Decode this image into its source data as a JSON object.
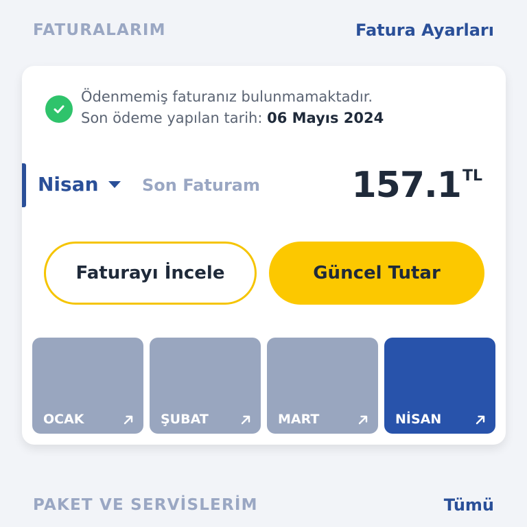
{
  "header": {
    "title": "FATURALARIM",
    "settings_link": "Fatura Ayarları"
  },
  "status": {
    "message": "Ödenmemiş faturanız bulunmamaktadır.",
    "last_payment_label": "Son ödeme yapılan tarih:",
    "last_payment_date": "06 Mayıs 2024"
  },
  "bill": {
    "selected_month": "Nisan",
    "label": "Son Faturam",
    "amount": "157.1",
    "currency": "TL"
  },
  "buttons": {
    "review": "Faturayı İncele",
    "current_amount": "Güncel Tutar"
  },
  "months": [
    {
      "label": "OCAK",
      "active": false
    },
    {
      "label": "ŞUBAT",
      "active": false
    },
    {
      "label": "MART",
      "active": false
    },
    {
      "label": "NİSAN",
      "active": true
    }
  ],
  "footer": {
    "title": "PAKET VE SERVİSLERİM",
    "all_link": "Tümü"
  },
  "colors": {
    "primary_blue": "#2a4f98",
    "accent_yellow": "#fcc800",
    "success_green": "#2fc36b",
    "tile_inactive": "#99a6bf",
    "tile_active": "#2853ab"
  }
}
